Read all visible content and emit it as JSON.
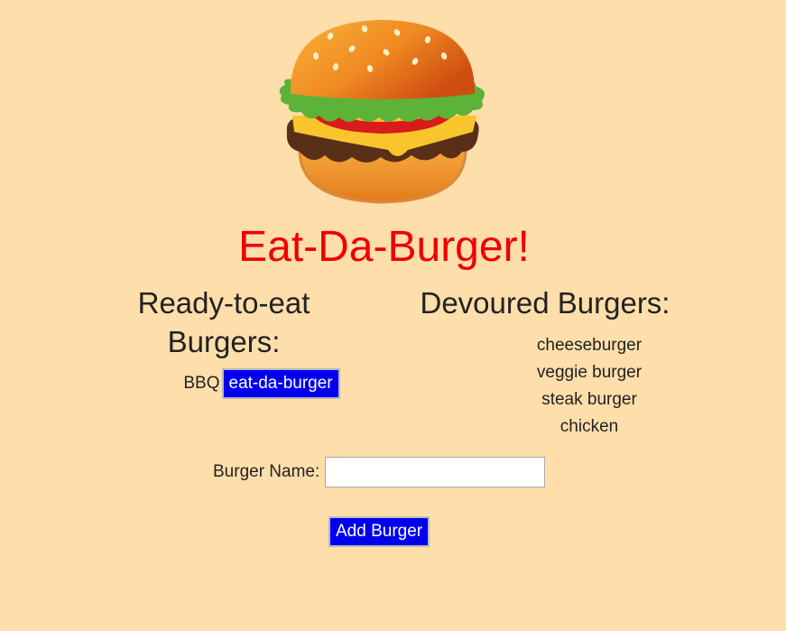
{
  "header": {
    "logo_icon": "hamburger-icon",
    "title": "Eat-Da-Burger!"
  },
  "ready": {
    "heading": "Ready-to-eat Burgers:",
    "items": [
      {
        "name": "BBQ",
        "button_label": "eat-da-burger"
      }
    ]
  },
  "devoured": {
    "heading": "Devoured Burgers:",
    "items": [
      "cheeseburger",
      "veggie burger",
      "steak burger",
      "chicken"
    ]
  },
  "form": {
    "label": "Burger Name:",
    "value": "",
    "submit_label": "Add Burger"
  },
  "colors": {
    "background": "#fedeab",
    "title": "#ee0000",
    "button": "#0000ee"
  }
}
